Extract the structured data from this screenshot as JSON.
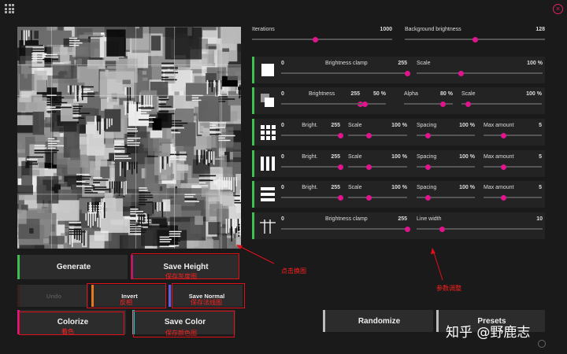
{
  "colors": {
    "accent_pink": "#e0148c",
    "panel_green": "#3fbf4f",
    "annotation_red": "#e0101a",
    "background": "#1a1a1a"
  },
  "icons": {
    "app_menu": "grid-dots-icon",
    "close": "close-icon"
  },
  "close_glyph": "×",
  "buttons": {
    "generate": "Generate",
    "save_height": "Save Height",
    "undo": "Undo",
    "invert": "Invert",
    "save_normal": "Save Normal",
    "colorize": "Colorize",
    "save_color": "Save Color",
    "randomize": "Randomize",
    "presets": "Presets"
  },
  "annotations": {
    "save_height": "保存灰度图",
    "invert": "反相",
    "save_normal": "保存法线图",
    "colorize": "着色",
    "save_color": "保存颜色图",
    "click_swap": "点击换图",
    "param_adjust": "参数调整"
  },
  "watermark": "知乎 @野鹿志",
  "top_controls": [
    {
      "label": "Iterations",
      "value": "1000",
      "level": 0.45
    },
    {
      "label": "Background brightness",
      "value": "128",
      "level": 0.5
    }
  ],
  "panels": [
    {
      "icon": "square-icon",
      "controls": [
        {
          "min": "0",
          "label": "Brightness clamp",
          "value": "255",
          "level": 1.0
        },
        {
          "label": "Scale",
          "value": "100 %",
          "level": 0.35
        }
      ]
    },
    {
      "icon": "overlapping-squares-icon",
      "controls": [
        {
          "min": "0",
          "label": "Brightness",
          "value": "255",
          "level": 1.0
        },
        {
          "label": "",
          "value": "50 %",
          "level": 0.5
        },
        {
          "label": "Alpha",
          "value": "80 %",
          "level": 0.8
        },
        {
          "label": "Scale",
          "value": "100 %",
          "level": 0.08
        }
      ]
    },
    {
      "icon": "grid-squares-icon",
      "controls": [
        {
          "min": "0",
          "label": "Bright.",
          "value": "255",
          "level": 1.0
        },
        {
          "label": "Scale",
          "value": "100 %",
          "level": 0.35
        },
        {
          "label": "Spacing",
          "value": "100 %",
          "level": 0.2
        },
        {
          "label": "Max amount",
          "value": "5",
          "level": 0.35
        }
      ]
    },
    {
      "icon": "vertical-bars-icon",
      "controls": [
        {
          "min": "0",
          "label": "Bright.",
          "value": "255",
          "level": 1.0
        },
        {
          "label": "Scale",
          "value": "100 %",
          "level": 0.35
        },
        {
          "label": "Spacing",
          "value": "100 %",
          "level": 0.2
        },
        {
          "label": "Max amount",
          "value": "5",
          "level": 0.35
        }
      ]
    },
    {
      "icon": "horizontal-bars-icon",
      "controls": [
        {
          "min": "0",
          "label": "Bright.",
          "value": "255",
          "level": 1.0
        },
        {
          "label": "Scale",
          "value": "100 %",
          "level": 0.35
        },
        {
          "label": "Spacing",
          "value": "100 %",
          "level": 0.2
        },
        {
          "label": "Max amount",
          "value": "5",
          "level": 0.35
        }
      ]
    },
    {
      "icon": "crossed-lines-icon",
      "controls": [
        {
          "min": "0",
          "label": "Brightness clamp",
          "value": "255",
          "level": 1.0
        },
        {
          "label": "Line width",
          "value": "10",
          "level": 0.2
        }
      ]
    }
  ]
}
